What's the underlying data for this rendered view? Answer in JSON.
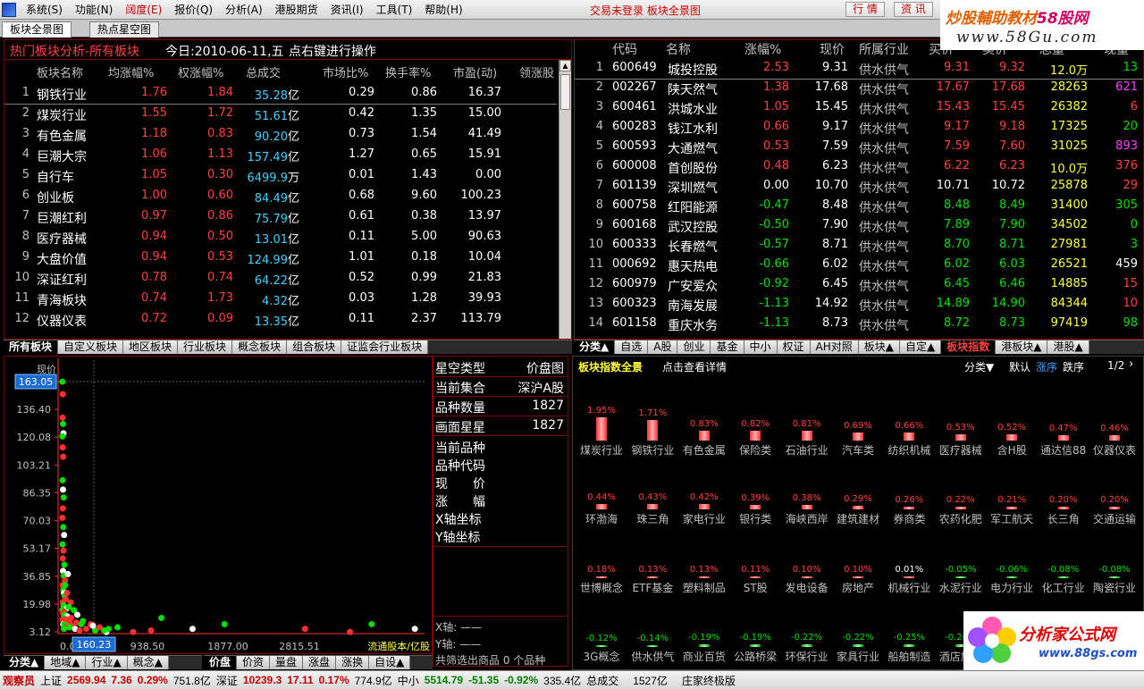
{
  "menu": {
    "items": [
      {
        "label": "系统(S)",
        "hl": false
      },
      {
        "label": "功能(N)",
        "hl": false
      },
      {
        "label": "阔度(E)",
        "hl": true
      },
      {
        "label": "报价(Q)",
        "hl": false
      },
      {
        "label": "分析(A)",
        "hl": false
      },
      {
        "label": "港股期货",
        "hl": false
      },
      {
        "label": "资讯(I)",
        "hl": false
      },
      {
        "label": "工具(T)",
        "hl": false
      },
      {
        "label": "帮助(H)",
        "hl": false
      }
    ],
    "status": "交易未登录  板块全景图",
    "btn_trade": "行 情",
    "btn_info": "资 讯"
  },
  "brand": {
    "line1a": "炒股輔助教材",
    "line1b": "58股网",
    "line2": "www.58Gu.com"
  },
  "tabs": {
    "t1": "板块全景图",
    "t2": "热点星空图"
  },
  "sector_panel": {
    "title": "热门板块分析-所有板块",
    "date": "今日:2010-06-11,五",
    "hint": "点右键进行操作",
    "headers": [
      "板块名称",
      "均涨幅%",
      "权涨幅%",
      "总成交",
      "市场比%",
      "换手率%",
      "市盈(动)",
      "领涨股"
    ],
    "rows": [
      {
        "n": "1",
        "name": "钢铁行业",
        "avg": "1.76",
        "w": "1.84",
        "vol": "35.28",
        "u": "亿",
        "mkt": "0.29",
        "turn": "0.86",
        "pe": "16.37"
      },
      {
        "n": "2",
        "name": "煤炭行业",
        "avg": "1.55",
        "w": "1.72",
        "vol": "51.61",
        "u": "亿",
        "mkt": "0.42",
        "turn": "1.35",
        "pe": "15.00"
      },
      {
        "n": "3",
        "name": "有色金属",
        "avg": "1.18",
        "w": "0.83",
        "vol": "90.20",
        "u": "亿",
        "mkt": "0.73",
        "turn": "1.54",
        "pe": "41.49"
      },
      {
        "n": "4",
        "name": "巨潮大宗",
        "avg": "1.06",
        "w": "1.13",
        "vol": "157.49",
        "u": "亿",
        "mkt": "1.27",
        "turn": "0.65",
        "pe": "15.91"
      },
      {
        "n": "5",
        "name": "自行车",
        "avg": "1.05",
        "w": "0.30",
        "vol": "6499.9",
        "u": "万",
        "mkt": "0.01",
        "turn": "1.43",
        "pe": "0.00"
      },
      {
        "n": "6",
        "name": "创业板",
        "avg": "1.00",
        "w": "0.60",
        "vol": "84.49",
        "u": "亿",
        "mkt": "0.68",
        "turn": "9.60",
        "pe": "100.23"
      },
      {
        "n": "7",
        "name": "巨潮红利",
        "avg": "0.97",
        "w": "0.86",
        "vol": "75.79",
        "u": "亿",
        "mkt": "0.61",
        "turn": "0.38",
        "pe": "13.97"
      },
      {
        "n": "8",
        "name": "医疗器械",
        "avg": "0.94",
        "w": "0.50",
        "vol": "13.01",
        "u": "亿",
        "mkt": "0.11",
        "turn": "5.00",
        "pe": "90.63"
      },
      {
        "n": "9",
        "name": "大盘价值",
        "avg": "0.94",
        "w": "0.53",
        "vol": "124.99",
        "u": "亿",
        "mkt": "1.01",
        "turn": "0.18",
        "pe": "10.04"
      },
      {
        "n": "10",
        "name": "深证红利",
        "avg": "0.78",
        "w": "0.74",
        "vol": "64.22",
        "u": "亿",
        "mkt": "0.52",
        "turn": "0.99",
        "pe": "21.83"
      },
      {
        "n": "11",
        "name": "青海板块",
        "avg": "0.74",
        "w": "1.73",
        "vol": "4.32",
        "u": "亿",
        "mkt": "0.03",
        "turn": "1.28",
        "pe": "39.93"
      },
      {
        "n": "12",
        "name": "仪器仪表",
        "avg": "0.72",
        "w": "0.09",
        "vol": "13.35",
        "u": "亿",
        "mkt": "0.11",
        "turn": "2.37",
        "pe": "113.79"
      }
    ]
  },
  "left_tabs": [
    "所有板块",
    "自定义板块",
    "地区板块",
    "行业板块",
    "概念板块",
    "组合板块",
    "证监会行业板块"
  ],
  "stock_panel": {
    "headers": [
      "代码",
      "名称",
      "涨幅%",
      "现价",
      "所属行业",
      "买价",
      "卖价",
      "总量",
      "现量"
    ],
    "rows": [
      {
        "n": "1",
        "code": "600649",
        "name": "城投控股",
        "chg": "2.53",
        "price": "9.31",
        "ind": "供水供气",
        "bid": "9.31",
        "ask": "9.32",
        "vol": "12.0万",
        "cur": "13",
        "c": "red",
        "cc": "green"
      },
      {
        "n": "2",
        "code": "002267",
        "name": "陕天然气",
        "chg": "1.38",
        "price": "17.68",
        "ind": "供水供气",
        "bid": "17.67",
        "ask": "17.68",
        "vol": "28263",
        "cur": "621",
        "c": "red",
        "cc": "magenta"
      },
      {
        "n": "3",
        "code": "600461",
        "name": "洪城水业",
        "chg": "1.05",
        "price": "15.45",
        "ind": "供水供气",
        "bid": "15.43",
        "ask": "15.45",
        "vol": "26382",
        "cur": "6",
        "c": "red",
        "cc": "red"
      },
      {
        "n": "4",
        "code": "600283",
        "name": "钱江水利",
        "chg": "0.66",
        "price": "9.17",
        "ind": "供水供气",
        "bid": "9.17",
        "ask": "9.18",
        "vol": "17325",
        "cur": "20",
        "c": "red",
        "cc": "green"
      },
      {
        "n": "5",
        "code": "600593",
        "name": "大通燃气",
        "chg": "0.53",
        "price": "7.59",
        "ind": "供水供气",
        "bid": "7.59",
        "ask": "7.60",
        "vol": "31025",
        "cur": "893",
        "c": "red",
        "cc": "magenta"
      },
      {
        "n": "6",
        "code": "600008",
        "name": "首创股份",
        "chg": "0.48",
        "price": "6.23",
        "ind": "供水供气",
        "bid": "6.22",
        "ask": "6.23",
        "vol": "10.0万",
        "cur": "376",
        "c": "red",
        "cc": "red"
      },
      {
        "n": "7",
        "code": "601139",
        "name": "深圳燃气",
        "chg": "0.00",
        "price": "10.70",
        "ind": "供水供气",
        "bid": "10.71",
        "ask": "10.72",
        "vol": "25878",
        "cur": "29",
        "c": "white",
        "cc": "red"
      },
      {
        "n": "8",
        "code": "600758",
        "name": "红阳能源",
        "chg": "-0.47",
        "price": "8.48",
        "ind": "供水供气",
        "bid": "8.48",
        "ask": "8.49",
        "vol": "31400",
        "cur": "305",
        "c": "green",
        "cc": "green"
      },
      {
        "n": "9",
        "code": "600168",
        "name": "武汉控股",
        "chg": "-0.50",
        "price": "7.90",
        "ind": "供水供气",
        "bid": "7.89",
        "ask": "7.90",
        "vol": "34502",
        "cur": "0",
        "c": "green",
        "cc": "green"
      },
      {
        "n": "10",
        "code": "600333",
        "name": "长春燃气",
        "chg": "-0.57",
        "price": "8.71",
        "ind": "供水供气",
        "bid": "8.70",
        "ask": "8.71",
        "vol": "27981",
        "cur": "3",
        "c": "green",
        "cc": "green"
      },
      {
        "n": "11",
        "code": "000692",
        "name": "惠天热电",
        "chg": "-0.66",
        "price": "6.02",
        "ind": "供水供气",
        "bid": "6.02",
        "ask": "6.03",
        "vol": "26521",
        "cur": "459",
        "c": "green",
        "cc": "white"
      },
      {
        "n": "12",
        "code": "600979",
        "name": "广安爱众",
        "chg": "-0.92",
        "price": "6.45",
        "ind": "供水供气",
        "bid": "6.45",
        "ask": "6.46",
        "vol": "14885",
        "cur": "15",
        "c": "green",
        "cc": "red"
      },
      {
        "n": "13",
        "code": "600323",
        "name": "南海发展",
        "chg": "-1.13",
        "price": "14.92",
        "ind": "供水供气",
        "bid": "14.89",
        "ask": "14.90",
        "vol": "84344",
        "cur": "10",
        "c": "green",
        "cc": "red"
      },
      {
        "n": "14",
        "code": "601158",
        "name": "重庆水务",
        "chg": "-1.13",
        "price": "8.73",
        "ind": "供水供气",
        "bid": "8.72",
        "ask": "8.73",
        "vol": "97419",
        "cur": "98",
        "c": "green",
        "cc": "green"
      }
    ]
  },
  "right_tabs": [
    "分类▲",
    "自选",
    "A股",
    "创业",
    "基金",
    "中小",
    "权证",
    "AH对照",
    "板块▲",
    "自定▲",
    "板块指数",
    "港板块▲",
    "港股▲"
  ],
  "star_info": {
    "rows": [
      {
        "k": "星空类型",
        "v": "价盘图"
      },
      {
        "k": "当前集合",
        "v": "深沪A股"
      },
      {
        "k": "品种数量",
        "v": "1827"
      },
      {
        "k": "画面星星",
        "v": "1827"
      }
    ],
    "fields": [
      "当前品种",
      "品种代码",
      "现　　价",
      "涨　　幅",
      "X轴坐标",
      "Y轴坐标"
    ],
    "xaxis": "X轴: ——",
    "yaxis": "Y轴: ——",
    "summary": "共筛选出商品 0 个品种"
  },
  "chart_data": {
    "type": "scatter",
    "ylabel": "现价",
    "xlabel": "流通股本/亿股",
    "y_ticks": [
      "163.05",
      "136.40",
      "120.08",
      "103.21",
      "86.35",
      "70.03",
      "53.17",
      "36.85",
      "19.98",
      "3.12"
    ],
    "x_ticks": [
      "0.0",
      "938.50",
      "1877.00",
      "2815.51"
    ],
    "cursor_y": "163.05",
    "cursor_x": "160.23",
    "points": [
      [
        3,
        163
      ],
      [
        5,
        155
      ],
      [
        4,
        140
      ],
      [
        6,
        136
      ],
      [
        8,
        130
      ],
      [
        3,
        128
      ],
      [
        5,
        121
      ],
      [
        7,
        115
      ],
      [
        4,
        100
      ],
      [
        6,
        94
      ],
      [
        9,
        89
      ],
      [
        5,
        82
      ],
      [
        3,
        76
      ],
      [
        7,
        70
      ],
      [
        11,
        65
      ],
      [
        4,
        59
      ],
      [
        8,
        55
      ],
      [
        5,
        50
      ],
      [
        12,
        46
      ],
      [
        6,
        42
      ],
      [
        9,
        39
      ],
      [
        15,
        36
      ],
      [
        4,
        33
      ],
      [
        7,
        30
      ],
      [
        10,
        28
      ],
      [
        13,
        26
      ],
      [
        18,
        24
      ],
      [
        5,
        22
      ],
      [
        8,
        20
      ],
      [
        22,
        18
      ],
      [
        3,
        17
      ],
      [
        11,
        16
      ],
      [
        6,
        15
      ],
      [
        14,
        14
      ],
      [
        25,
        13
      ],
      [
        9,
        12
      ],
      [
        4,
        11
      ],
      [
        17,
        10
      ],
      [
        30,
        9
      ],
      [
        7,
        8
      ],
      [
        12,
        8
      ],
      [
        45,
        7
      ],
      [
        20,
        6
      ],
      [
        35,
        6
      ],
      [
        60,
        5
      ],
      [
        10,
        5
      ],
      [
        80,
        4
      ],
      [
        110,
        5
      ],
      [
        150,
        4
      ],
      [
        200,
        3
      ],
      [
        250,
        6
      ],
      [
        320,
        3
      ],
      [
        400,
        4
      ],
      [
        520,
        12
      ],
      [
        880,
        5
      ],
      [
        1250,
        8
      ],
      [
        2180,
        5
      ],
      [
        2700,
        3
      ],
      [
        2950,
        8
      ],
      [
        3450,
        5
      ],
      [
        16,
        33
      ],
      [
        24,
        28
      ],
      [
        40,
        22
      ],
      [
        55,
        17
      ],
      [
        70,
        14
      ],
      [
        95,
        10
      ],
      [
        130,
        8
      ],
      [
        170,
        6
      ],
      [
        210,
        5
      ],
      [
        28,
        40
      ],
      [
        32,
        19
      ],
      [
        42,
        12
      ],
      [
        66,
        9
      ],
      [
        88,
        8
      ],
      [
        140,
        7
      ],
      [
        190,
        4
      ],
      [
        21,
        11
      ],
      [
        36,
        10
      ]
    ]
  },
  "index_panel": {
    "title": "板块指数全景",
    "hint": "点击查看详情",
    "sort_label": "分类▼",
    "sort_opts": [
      "默认",
      "涨序",
      "跌序"
    ],
    "page": "1/2",
    "tiles": [
      {
        "pct": "1.95%",
        "v": 1.95,
        "name": "煤炭行业"
      },
      {
        "pct": "1.71%",
        "v": 1.71,
        "name": "钢铁行业"
      },
      {
        "pct": "0.83%",
        "v": 0.83,
        "name": "有色金属"
      },
      {
        "pct": "0.82%",
        "v": 0.82,
        "name": "保险类"
      },
      {
        "pct": "0.81%",
        "v": 0.81,
        "name": "石油行业"
      },
      {
        "pct": "0.69%",
        "v": 0.69,
        "name": "汽车类"
      },
      {
        "pct": "0.66%",
        "v": 0.66,
        "name": "纺织机械"
      },
      {
        "pct": "0.53%",
        "v": 0.53,
        "name": "医疗器械"
      },
      {
        "pct": "0.52%",
        "v": 0.52,
        "name": "含H股"
      },
      {
        "pct": "0.47%",
        "v": 0.47,
        "name": "通达信88"
      },
      {
        "pct": "0.46%",
        "v": 0.46,
        "name": "仪器仪表"
      },
      {
        "pct": "0.44%",
        "v": 0.44,
        "name": "环渤海"
      },
      {
        "pct": "0.43%",
        "v": 0.43,
        "name": "珠三角"
      },
      {
        "pct": "0.42%",
        "v": 0.42,
        "name": "家电行业"
      },
      {
        "pct": "0.39%",
        "v": 0.39,
        "name": "银行类"
      },
      {
        "pct": "0.38%",
        "v": 0.38,
        "name": "海峡西岸"
      },
      {
        "pct": "0.29%",
        "v": 0.29,
        "name": "建筑建材"
      },
      {
        "pct": "0.26%",
        "v": 0.26,
        "name": "券商类"
      },
      {
        "pct": "0.22%",
        "v": 0.22,
        "name": "农药化肥"
      },
      {
        "pct": "0.21%",
        "v": 0.21,
        "name": "军工航天"
      },
      {
        "pct": "0.20%",
        "v": 0.2,
        "name": "长三角"
      },
      {
        "pct": "0.20%",
        "v": 0.2,
        "name": "交通运输"
      },
      {
        "pct": "0.18%",
        "v": 0.18,
        "name": "世博概念"
      },
      {
        "pct": "0.13%",
        "v": 0.13,
        "name": "ETF基金"
      },
      {
        "pct": "0.13%",
        "v": 0.13,
        "name": "塑料制品"
      },
      {
        "pct": "0.11%",
        "v": 0.11,
        "name": "ST股"
      },
      {
        "pct": "0.10%",
        "v": 0.1,
        "name": "发电设备"
      },
      {
        "pct": "0.10%",
        "v": 0.1,
        "name": "房地产"
      },
      {
        "pct": "0.01%",
        "v": 0.01,
        "name": "机械行业"
      },
      {
        "pct": "-0.05%",
        "v": -0.05,
        "name": "水泥行业"
      },
      {
        "pct": "-0.06%",
        "v": -0.06,
        "name": "电力行业"
      },
      {
        "pct": "-0.08%",
        "v": -0.08,
        "name": "化工行业"
      },
      {
        "pct": "-0.08%",
        "v": -0.08,
        "name": "陶瓷行业"
      },
      {
        "pct": "-0.12%",
        "v": -0.12,
        "name": "3G概念"
      },
      {
        "pct": "-0.14%",
        "v": -0.14,
        "name": "供水供气"
      },
      {
        "pct": "-0.19%",
        "v": -0.19,
        "name": "商业百货"
      },
      {
        "pct": "-0.19%",
        "v": -0.19,
        "name": "公路桥梁"
      },
      {
        "pct": "-0.22%",
        "v": -0.22,
        "name": "环保行业"
      },
      {
        "pct": "-0.22%",
        "v": -0.22,
        "name": "家具行业"
      },
      {
        "pct": "-0.25%",
        "v": -0.25,
        "name": "船舶制造"
      },
      {
        "pct": "-0.26%",
        "v": -0.26,
        "name": "酒店旅游"
      }
    ]
  },
  "bottom_left_tabs": [
    "分类▲",
    "地域▲",
    "行业▲",
    "概念▲"
  ],
  "bottom_mid_tabs": [
    "价盘",
    "价资",
    "量盘",
    "涨盘",
    "涨换",
    "自设▲"
  ],
  "statusbar": {
    "role": "观察员",
    "sh_label": "上证",
    "sh_val": "2569.94",
    "sh_chg": "7.36",
    "sh_pct": "0.29%",
    "sh_amt": "751.8亿",
    "sz_label": "深证",
    "sz_val": "10239.3",
    "sz_chg": "17.11",
    "sz_pct": "0.17%",
    "sz_amt": "774.9亿",
    "zx_label": "中小",
    "zx_val": "5514.79",
    "zx_chg": "-51.35",
    "zx_pct": "-0.92%",
    "zx_amt": "335.4亿",
    "total_label": "总成交",
    "total_val": "1527亿",
    "broker": "庄家终极版"
  },
  "logo2": {
    "text": "分析家公式网",
    "url": "www.88gs.com"
  }
}
